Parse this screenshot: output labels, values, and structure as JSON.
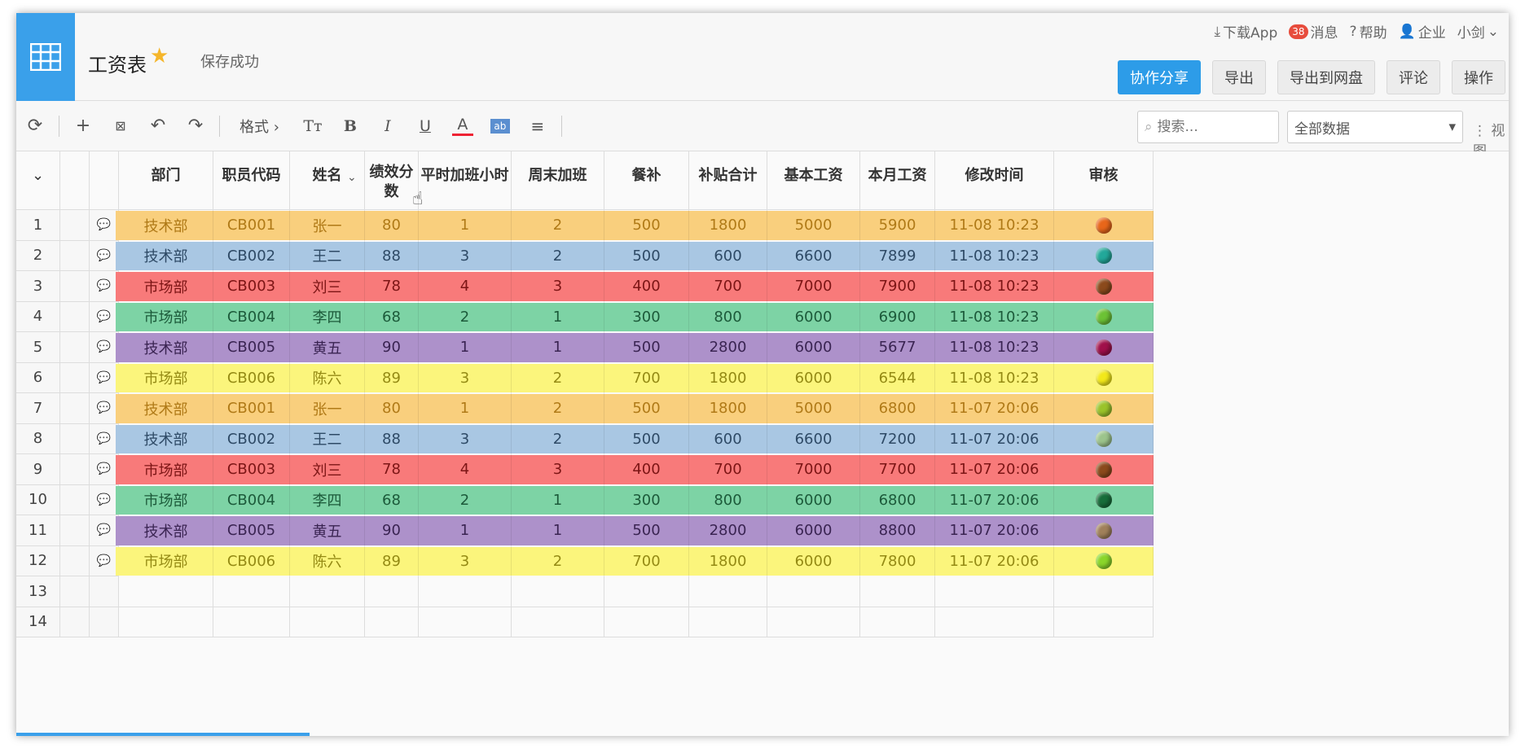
{
  "app": {
    "title": "工资表",
    "save_status": "保存成功"
  },
  "top_links": {
    "download": "下载App",
    "messages_badge": "38",
    "messages": "消息",
    "help": "帮助",
    "enterprise": "企业",
    "user": "小剑"
  },
  "actions": {
    "share": "协作分享",
    "export": "导出",
    "export_drive": "导出到网盘",
    "comment": "评论",
    "operate": "操作"
  },
  "toolbar": {
    "format": "格式",
    "search_placeholder": "搜索...",
    "data_filter": "全部数据",
    "view": "视图"
  },
  "table": {
    "columns": [
      "部门",
      "职员代码",
      "姓名",
      "绩效分数",
      "平时加班小时",
      "周末加班",
      "餐补",
      "补贴合计",
      "基本工资",
      "本月工资",
      "修改时间",
      "审核"
    ],
    "rows": [
      {
        "num": "1",
        "bg": "#f9cf7d",
        "fg": "#b07a17",
        "cells": [
          "技术部",
          "CB001",
          "张一",
          "80",
          "1",
          "2",
          "500",
          "1800",
          "5000",
          "5900",
          "11-08 10:23"
        ],
        "status_color": "#e8661a"
      },
      {
        "num": "2",
        "bg": "#a9c7e3",
        "fg": "#2e4a66",
        "cells": [
          "技术部",
          "CB002",
          "王二",
          "88",
          "3",
          "2",
          "500",
          "600",
          "6600",
          "7899",
          "11-08 10:23"
        ],
        "status_color": "#22a89a"
      },
      {
        "num": "3",
        "bg": "#f87a7a",
        "fg": "#7c1515",
        "cells": [
          "市场部",
          "CB003",
          "刘三",
          "78",
          "4",
          "3",
          "400",
          "700",
          "7000",
          "7900",
          "11-08 10:23"
        ],
        "status_color": "#8b4a1c"
      },
      {
        "num": "4",
        "bg": "#7dd3a5",
        "fg": "#1c5a3a",
        "cells": [
          "市场部",
          "CB004",
          "李四",
          "68",
          "2",
          "1",
          "300",
          "800",
          "6000",
          "6900",
          "11-08 10:23"
        ],
        "status_color": "#6cc235"
      },
      {
        "num": "5",
        "bg": "#ad91ca",
        "fg": "#3a2452",
        "cells": [
          "技术部",
          "CB005",
          "黄五",
          "90",
          "1",
          "1",
          "500",
          "2800",
          "6000",
          "5677",
          "11-08 10:23"
        ],
        "status_color": "#a0104a"
      },
      {
        "num": "6",
        "bg": "#fbf57c",
        "fg": "#948a14",
        "cells": [
          "市场部",
          "CB006",
          "陈六",
          "89",
          "3",
          "2",
          "700",
          "1800",
          "6000",
          "6544",
          "11-08 10:23"
        ],
        "status_color": "#f2e81a"
      },
      {
        "num": "7",
        "bg": "#f9cf7d",
        "fg": "#b07a17",
        "cells": [
          "技术部",
          "CB001",
          "张一",
          "80",
          "1",
          "2",
          "500",
          "1800",
          "5000",
          "6800",
          "11-07 20:06"
        ],
        "status_color": "#9ac32a"
      },
      {
        "num": "8",
        "bg": "#a9c7e3",
        "fg": "#2e4a66",
        "cells": [
          "技术部",
          "CB002",
          "王二",
          "88",
          "3",
          "2",
          "500",
          "600",
          "6600",
          "7200",
          "11-07 20:06"
        ],
        "status_color": "#9cc48c"
      },
      {
        "num": "9",
        "bg": "#f87a7a",
        "fg": "#7c1515",
        "cells": [
          "市场部",
          "CB003",
          "刘三",
          "78",
          "4",
          "3",
          "400",
          "700",
          "7000",
          "7700",
          "11-07 20:06"
        ],
        "status_color": "#8b4a1c"
      },
      {
        "num": "10",
        "bg": "#7dd3a5",
        "fg": "#1c5a3a",
        "cells": [
          "市场部",
          "CB004",
          "李四",
          "68",
          "2",
          "1",
          "300",
          "800",
          "6000",
          "6800",
          "11-07 20:06"
        ],
        "status_color": "#176d3a"
      },
      {
        "num": "11",
        "bg": "#ad91ca",
        "fg": "#3a2452",
        "cells": [
          "技术部",
          "CB005",
          "黄五",
          "90",
          "1",
          "1",
          "500",
          "2800",
          "6000",
          "8800",
          "11-07 20:06"
        ],
        "status_color": "#a0805a"
      },
      {
        "num": "12",
        "bg": "#fbf57c",
        "fg": "#948a14",
        "cells": [
          "市场部",
          "CB006",
          "陈六",
          "89",
          "3",
          "2",
          "700",
          "1800",
          "6000",
          "7800",
          "11-07 20:06"
        ],
        "status_color": "#8ad62a"
      }
    ],
    "empty_rows": [
      "13",
      "14"
    ]
  },
  "icons": [
    "grid-table-icon",
    "star-icon",
    "download-icon",
    "help-icon",
    "user-icon",
    "refresh-icon",
    "add-icon",
    "excel-icon",
    "undo-icon",
    "redo-icon",
    "text-size-icon",
    "bold-icon",
    "italic-icon",
    "underline-icon",
    "font-color-icon",
    "fill-color-icon",
    "align-icon",
    "search-icon",
    "comment-icon",
    "cursor-icon"
  ]
}
